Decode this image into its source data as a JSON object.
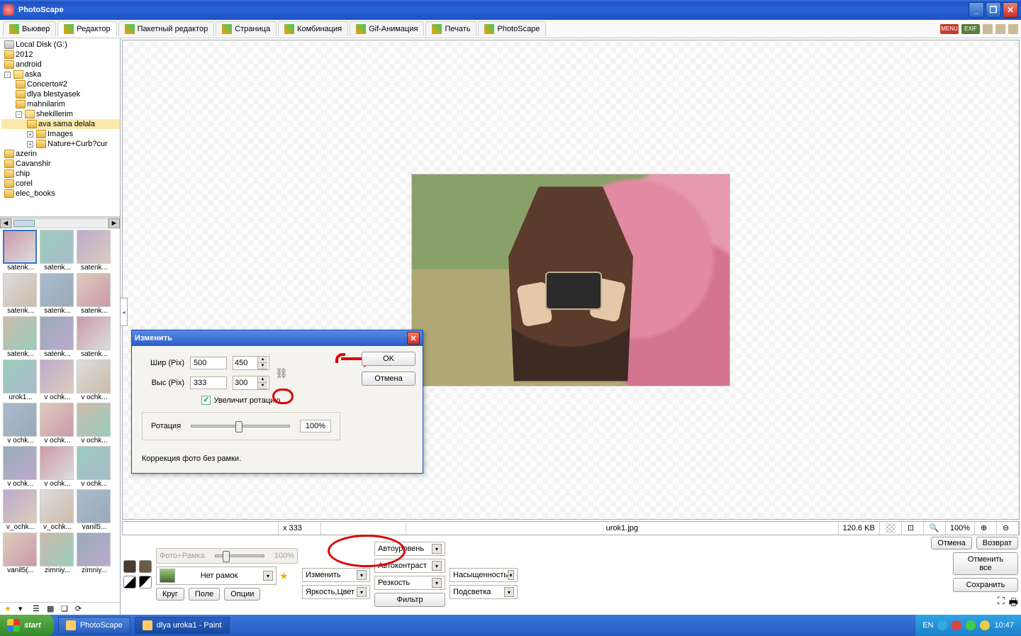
{
  "title": "PhotoScape",
  "tabs": [
    {
      "label": "Вьювер"
    },
    {
      "label": "Редактор",
      "active": true
    },
    {
      "label": "Пакетный редактор"
    },
    {
      "label": "Страница"
    },
    {
      "label": "Комбинация"
    },
    {
      "label": "Gif-Анимация"
    },
    {
      "label": "Печать"
    },
    {
      "label": "PhotoScape"
    }
  ],
  "badges": {
    "menu": "MENU",
    "exif": "EXIF"
  },
  "tree": [
    {
      "indent": 0,
      "icon": "disk",
      "label": "Local Disk (G:)"
    },
    {
      "indent": 0,
      "icon": "folder",
      "label": "2012"
    },
    {
      "indent": 0,
      "icon": "folder",
      "label": "android"
    },
    {
      "indent": 0,
      "icon": "folder-open",
      "label": "aska",
      "box": "-"
    },
    {
      "indent": 1,
      "icon": "folder",
      "label": "Concerto#2"
    },
    {
      "indent": 1,
      "icon": "folder",
      "label": "dlya blestyasek"
    },
    {
      "indent": 1,
      "icon": "folder",
      "label": "mahnilarim"
    },
    {
      "indent": 1,
      "icon": "folder-open",
      "label": "shekillerim",
      "box": "-"
    },
    {
      "indent": 2,
      "icon": "folder",
      "label": "ava sama delala",
      "sel": true
    },
    {
      "indent": 2,
      "icon": "folder",
      "label": "Images",
      "box": "+"
    },
    {
      "indent": 2,
      "icon": "folder",
      "label": "Nature+Curb?cur",
      "box": "+"
    },
    {
      "indent": 0,
      "icon": "folder",
      "label": "azerin"
    },
    {
      "indent": 0,
      "icon": "folder",
      "label": "Cavanshir"
    },
    {
      "indent": 0,
      "icon": "folder",
      "label": "chip"
    },
    {
      "indent": 0,
      "icon": "folder",
      "label": "corel"
    },
    {
      "indent": 0,
      "icon": "folder",
      "label": "elec_books"
    }
  ],
  "thumbs": [
    {
      "l": "satenk...",
      "sel": true
    },
    {
      "l": "satenk..."
    },
    {
      "l": "satenk..."
    },
    {
      "l": "satenk..."
    },
    {
      "l": "satenk..."
    },
    {
      "l": "satenk..."
    },
    {
      "l": "satenk..."
    },
    {
      "l": "satenk..."
    },
    {
      "l": "satenk..."
    },
    {
      "l": "urok1..."
    },
    {
      "l": "v ochk..."
    },
    {
      "l": "v ochk..."
    },
    {
      "l": "v ochk..."
    },
    {
      "l": "v ochk..."
    },
    {
      "l": "v ochk..."
    },
    {
      "l": "v ochk..."
    },
    {
      "l": "v ochk..."
    },
    {
      "l": "v ochk..."
    },
    {
      "l": "v_ochk..."
    },
    {
      "l": "v_ochk..."
    },
    {
      "l": "vanil5..."
    },
    {
      "l": "vanil5(..."
    },
    {
      "l": "zimniy..."
    },
    {
      "l": "zimniy..."
    }
  ],
  "status": {
    "dims": "x 333",
    "filename": "urok1.jpg",
    "size": "120.6 KB",
    "zoom": "100%"
  },
  "controls": {
    "photo_frame": "Фото+Рамка",
    "frame_pct": "100%",
    "no_frame": "Нет рамок",
    "resize": "Изменить",
    "brightness": "Яркость,Цвет",
    "autolevel": "Автоуровень",
    "autocontrast": "Автоконтраст",
    "sharpness": "Резкость",
    "saturation": "Насыщенность",
    "backlight": "Подсветка",
    "filter": "Фильтр",
    "circle": "Круг",
    "field": "Поле",
    "options": "Опции",
    "undo": "Отмена",
    "redo": "Возврат",
    "undoall": "Отменить все",
    "save": "Сохранить"
  },
  "dialog": {
    "title": "Изменить",
    "width_label": "Шир (Pix)",
    "height_label": "Выс (Pix)",
    "w_orig": "500",
    "w_new": "450",
    "h_orig": "333",
    "h_new": "300",
    "enlarge": "Увеличит ротацию",
    "rotation": "Ротация",
    "rot_pct": "100%",
    "hint": "Коррекция фото без рамки.",
    "ok": "OK",
    "cancel": "Отмена"
  },
  "taskbar": {
    "start": "start",
    "items": [
      {
        "l": "PhotoScape"
      },
      {
        "l": "dlya uroka1 - Paint",
        "active": true
      }
    ],
    "lang": "EN",
    "time": "10:47"
  }
}
